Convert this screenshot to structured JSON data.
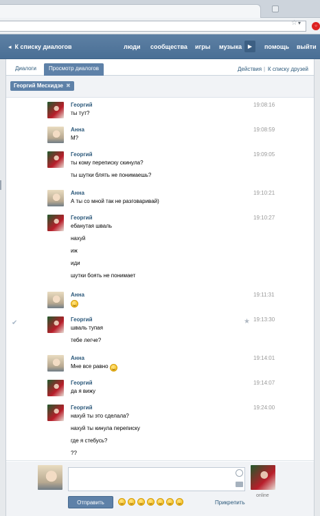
{
  "header": {
    "back_label": "К списку диалогов",
    "nav": [
      "люди",
      "сообщества",
      "игры",
      "музыка",
      "помощь",
      "выйти"
    ]
  },
  "tabs": {
    "items": [
      "Диалоги",
      "Просмотр диалогов"
    ],
    "active": "Просмотр диалогов",
    "actions_label": "Действия",
    "separator": "|",
    "friends_label": "К списку друзей"
  },
  "filter": {
    "chip_label": "Георгий Месхидзе",
    "chip_close": "✖"
  },
  "messages": [
    {
      "author": "Георгий",
      "time": "19:08:16",
      "lines": [
        "ты тут?"
      ]
    },
    {
      "author": "Анна",
      "time": "19:08:59",
      "lines": [
        "М?"
      ]
    },
    {
      "author": "Георгий",
      "time": "19:09:05",
      "lines": [
        "ты кому переписку скинула?",
        "ты шутки блять не понимаешь?"
      ]
    },
    {
      "author": "Анна",
      "time": "19:10:21",
      "lines": [
        "А ты со мной так не разговаривай)"
      ]
    },
    {
      "author": "Георгий",
      "time": "19:10:27",
      "lines": [
        "ебанутая шваль",
        "нахуй",
        "иж",
        "иди",
        "шутки боять не понимает"
      ]
    },
    {
      "author": "Анна",
      "time": "19:11:31",
      "lines": []
    },
    {
      "author": "Георгий",
      "time": "19:13:30",
      "lines": [
        "шваль тупая",
        "тебе легче?"
      ]
    },
    {
      "author": "Анна",
      "time": "19:14:01",
      "lines": [
        "Мне все равно"
      ]
    },
    {
      "author": "Георгий",
      "time": "19:14:07",
      "lines": [
        "да я вижу"
      ]
    },
    {
      "author": "Георгий",
      "time": "19:24:00",
      "lines": [
        "нахуй ты это сделала?",
        "нахуй ты кинула переписку",
        "где я стебусь?",
        "??"
      ]
    }
  ],
  "composer": {
    "send_label": "Отправить",
    "attach_label": "Прикрепить",
    "peer_status": "online",
    "text_value": ""
  },
  "icons": {
    "check": "✔",
    "star": "★",
    "back_arrow": "◂",
    "play": "▶"
  },
  "colors": {
    "header": "#52769b",
    "accent": "#5e81a8",
    "link": "#2b587a"
  }
}
